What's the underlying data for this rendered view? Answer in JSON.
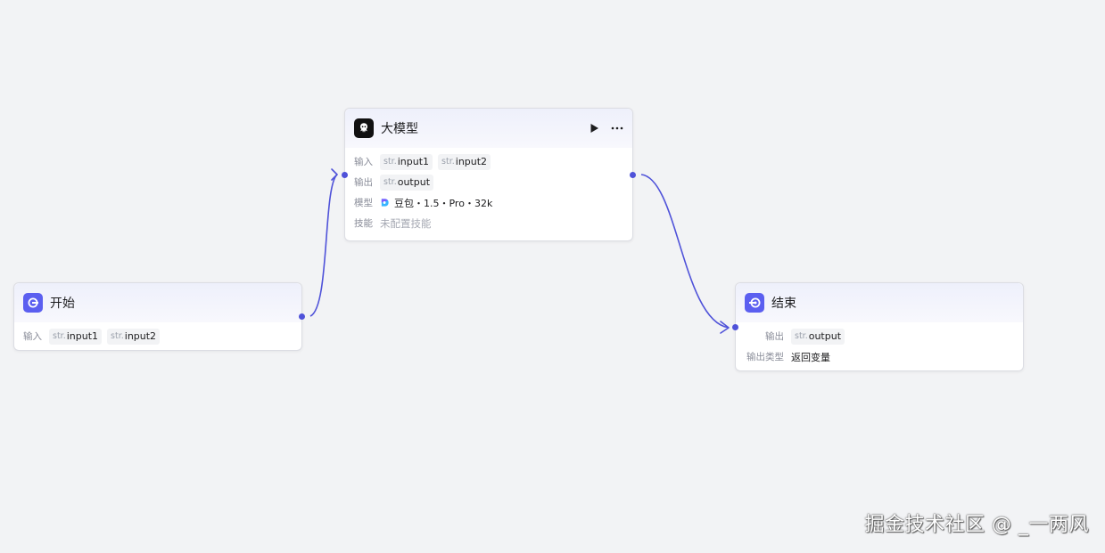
{
  "colors": {
    "accent": "#4f52d9",
    "canvas_bg": "#f2f3f5",
    "node_header_bg": "#eef0fb"
  },
  "nodes": {
    "start": {
      "title": "开始",
      "icon": "start-icon",
      "input_label": "输入",
      "inputs": [
        {
          "type": "str.",
          "name": "input1"
        },
        {
          "type": "str.",
          "name": "input2"
        }
      ]
    },
    "llm": {
      "title": "大模型",
      "icon": "llm-icon",
      "input_label": "输入",
      "inputs": [
        {
          "type": "str.",
          "name": "input1"
        },
        {
          "type": "str.",
          "name": "input2"
        }
      ],
      "output_label": "输出",
      "outputs": [
        {
          "type": "str.",
          "name": "output"
        }
      ],
      "model_label": "模型",
      "model_value": "豆包・1.5・Pro・32k",
      "skills_label": "技能",
      "skills_value": "未配置技能"
    },
    "end": {
      "title": "结束",
      "icon": "end-icon",
      "output_label": "输出",
      "outputs": [
        {
          "type": "str.",
          "name": "output"
        }
      ],
      "output_type_label": "输出类型",
      "output_type_value": "返回变量"
    }
  },
  "watermark": "掘金技术社区 @ _一两风"
}
